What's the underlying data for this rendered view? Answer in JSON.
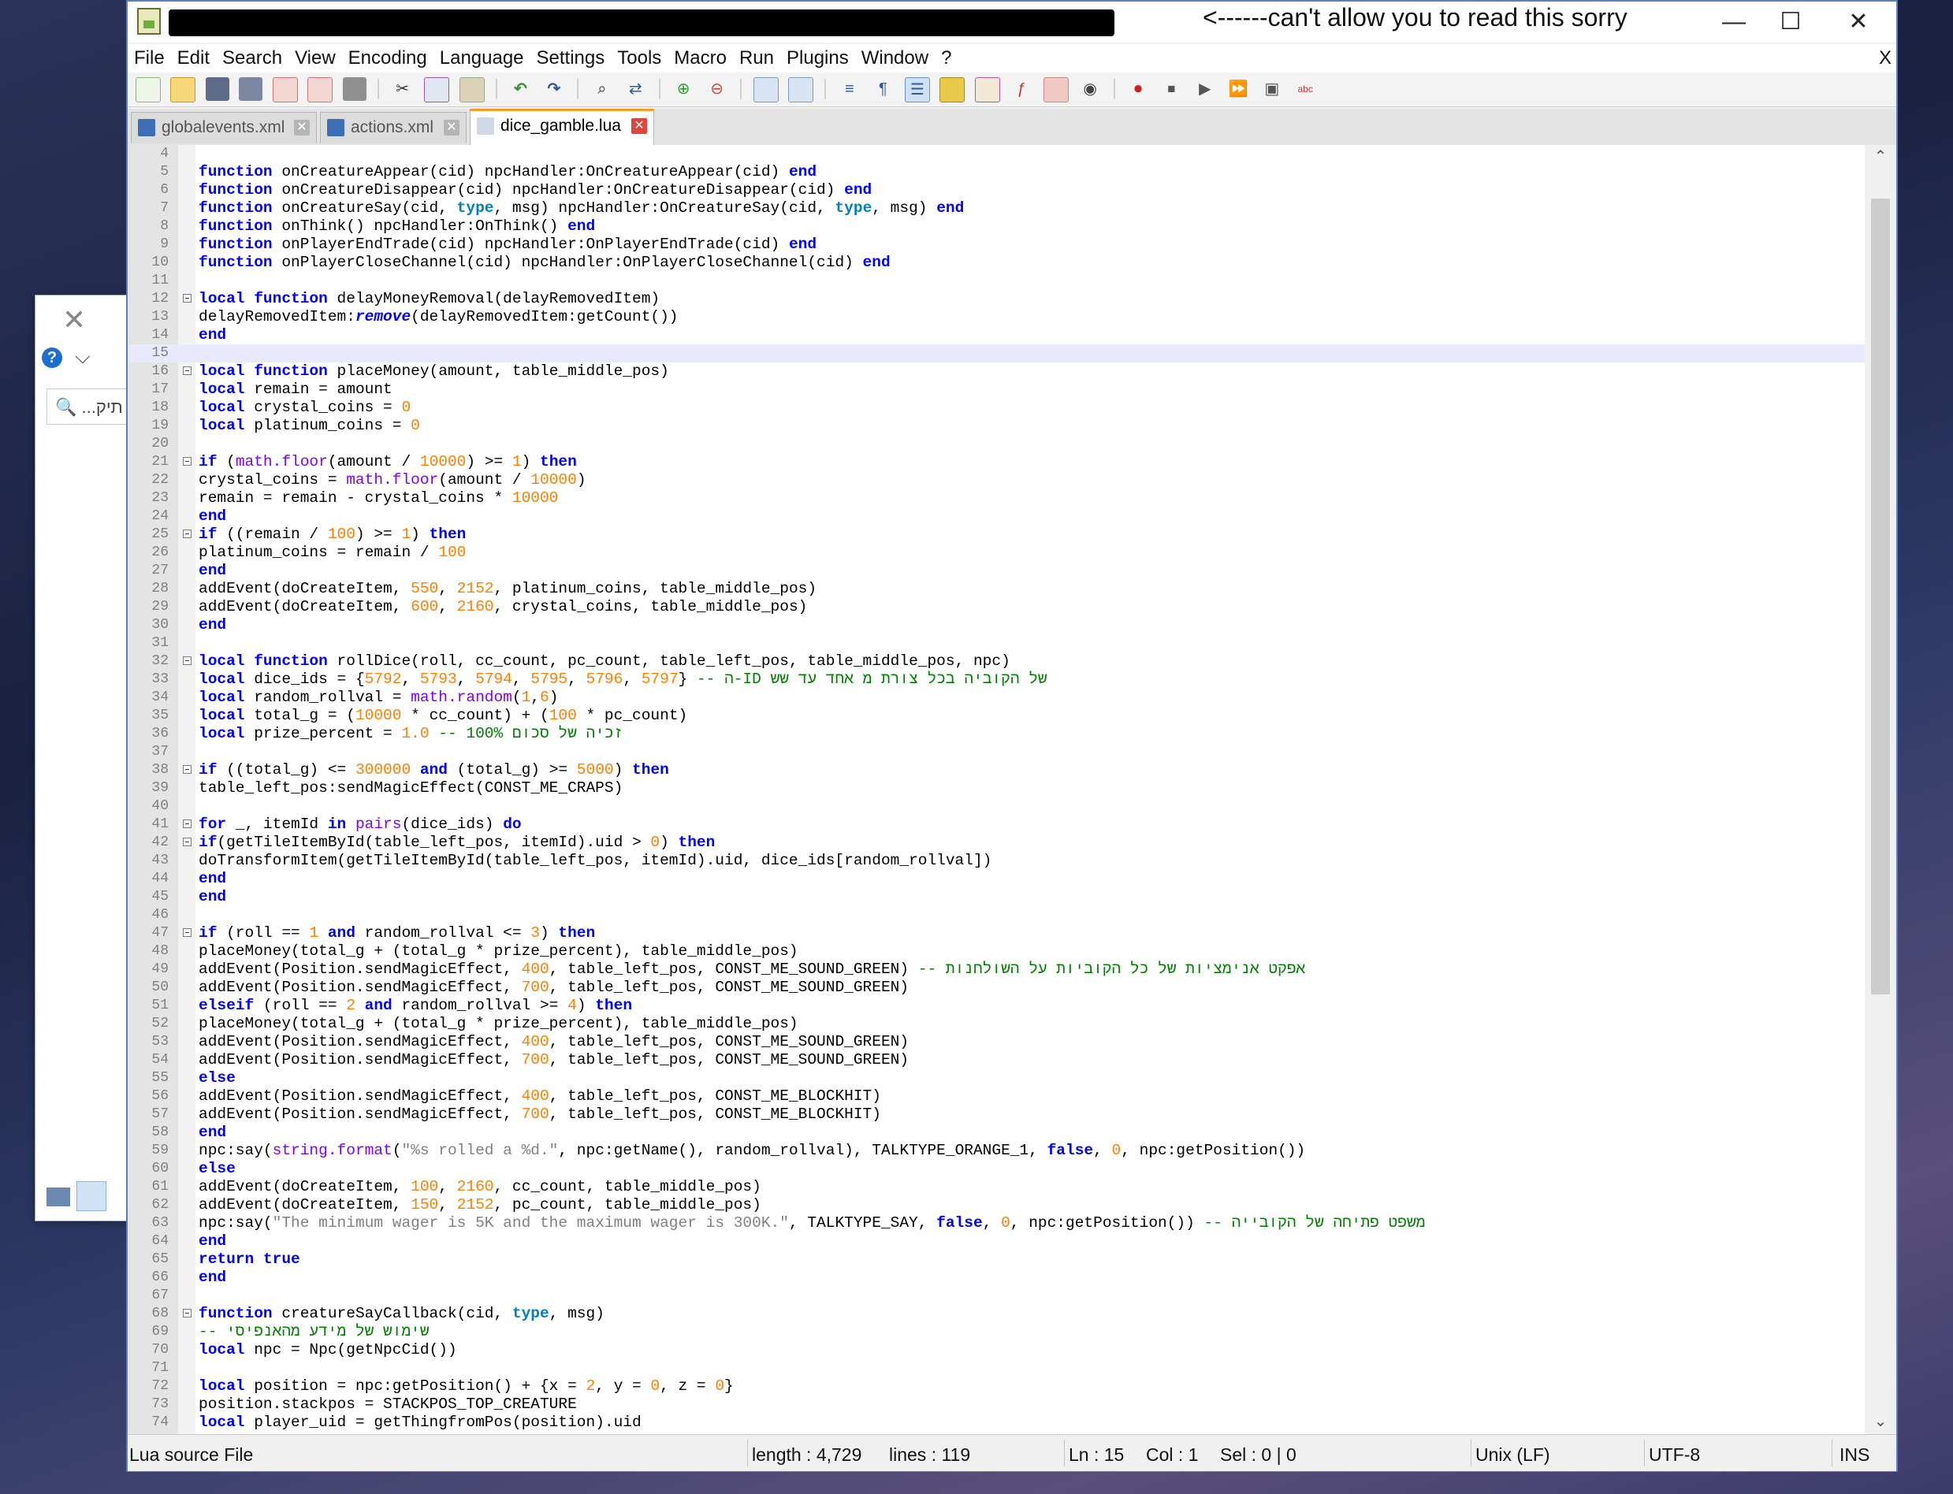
{
  "window": {
    "title_note": "<------can't allow you to read this sorry",
    "minimize": "—",
    "maximize": "☐",
    "close": "✕"
  },
  "bg_dialog": {
    "close": "✕",
    "help": "?",
    "chevron": "⌵",
    "search_text": "🔍 ...תיק"
  },
  "menu": [
    "File",
    "Edit",
    "Search",
    "View",
    "Encoding",
    "Language",
    "Settings",
    "Tools",
    "Macro",
    "Run",
    "Plugins",
    "Window",
    "?"
  ],
  "menu_close": "X",
  "tabs": [
    {
      "label": "globalevents.xml",
      "active": false
    },
    {
      "label": "actions.xml",
      "active": false
    },
    {
      "label": "dice_gamble.lua",
      "active": true
    }
  ],
  "tab_close": "✕",
  "current_line": 15,
  "code_lines": [
    {
      "n": "4",
      "h": ""
    },
    {
      "n": "5",
      "h": "<span class=\"kw\">function</span> onCreatureAppear(cid) npcHandler:OnCreatureAppear(cid) <span class=\"kw\">end</span>"
    },
    {
      "n": "6",
      "h": "<span class=\"kw\">function</span> onCreatureDisappear(cid) npcHandler:OnCreatureDisappear(cid) <span class=\"kw\">end</span>"
    },
    {
      "n": "7",
      "h": "<span class=\"kw\">function</span> onCreatureSay(cid, <span class=\"kwl\">type</span>, msg) npcHandler:OnCreatureSay(cid, <span class=\"kwl\">type</span>, msg) <span class=\"kw\">end</span>"
    },
    {
      "n": "8",
      "h": "<span class=\"kw\">function</span> onThink() npcHandler:OnThink() <span class=\"kw\">end</span>"
    },
    {
      "n": "9",
      "h": "<span class=\"kw\">function</span> onPlayerEndTrade(cid) npcHandler:OnPlayerEndTrade(cid) <span class=\"kw\">end</span>"
    },
    {
      "n": "10",
      "h": "<span class=\"kw\">function</span> onPlayerCloseChannel(cid) npcHandler:OnPlayerCloseChannel(cid) <span class=\"kw\">end</span>"
    },
    {
      "n": "11",
      "h": ""
    },
    {
      "n": "12",
      "f": 1,
      "h": "<span class=\"kw\">local</span> <span class=\"kw\">function</span> delayMoneyRemoval(delayRemovedItem)"
    },
    {
      "n": "13",
      "h": "delayRemovedItem:<span class=\"kw\"><i>remove</i></span>(delayRemovedItem:getCount())"
    },
    {
      "n": "14",
      "h": "<span class=\"kw\">end</span>"
    },
    {
      "n": "15",
      "h": ""
    },
    {
      "n": "16",
      "f": 1,
      "h": "<span class=\"kw\">local</span> <span class=\"kw\">function</span> placeMoney(amount, table_middle_pos)"
    },
    {
      "n": "17",
      "h": "<span class=\"kw\">local</span> remain = amount"
    },
    {
      "n": "18",
      "h": "<span class=\"kw\">local</span> crystal_coins = <span class=\"num\">0</span>"
    },
    {
      "n": "19",
      "h": "<span class=\"kw\">local</span> platinum_coins = <span class=\"num\">0</span>"
    },
    {
      "n": "20",
      "h": ""
    },
    {
      "n": "21",
      "f": 1,
      "h": "<span class=\"kw\">if</span> (<span class=\"lib\">math.floor</span>(amount / <span class=\"num\">10000</span>) >= <span class=\"num\">1</span>) <span class=\"kw\">then</span>"
    },
    {
      "n": "22",
      "h": "crystal_coins = <span class=\"lib\">math.floor</span>(amount / <span class=\"num\">10000</span>)"
    },
    {
      "n": "23",
      "h": "remain = remain - crystal_coins * <span class=\"num\">10000</span>"
    },
    {
      "n": "24",
      "h": "<span class=\"kw\">end</span>"
    },
    {
      "n": "25",
      "f": 1,
      "h": "<span class=\"kw\">if</span> ((remain / <span class=\"num\">100</span>) >= <span class=\"num\">1</span>) <span class=\"kw\">then</span>"
    },
    {
      "n": "26",
      "h": "platinum_coins = remain / <span class=\"num\">100</span>"
    },
    {
      "n": "27",
      "h": "<span class=\"kw\">end</span>"
    },
    {
      "n": "28",
      "h": "addEvent(doCreateItem, <span class=\"num\">550</span>, <span class=\"num\">2152</span>, platinum_coins, table_middle_pos)"
    },
    {
      "n": "29",
      "h": "addEvent(doCreateItem, <span class=\"num\">600</span>, <span class=\"num\">2160</span>, crystal_coins, table_middle_pos)"
    },
    {
      "n": "30",
      "h": "<span class=\"kw\">end</span>"
    },
    {
      "n": "31",
      "h": ""
    },
    {
      "n": "32",
      "f": 1,
      "h": "<span class=\"kw\">local</span> <span class=\"kw\">function</span> rollDice(roll, cc_count, pc_count, table_left_pos, table_middle_pos, npc)"
    },
    {
      "n": "33",
      "h": "<span class=\"kw\">local</span> dice_ids = {<span class=\"num\">5792</span>, <span class=\"num\">5793</span>, <span class=\"num\">5794</span>, <span class=\"num\">5795</span>, <span class=\"num\">5796</span>, <span class=\"num\">5797</span>} <span class=\"cmt\">-- ה-ID של הקוביה בכל צורת מ אחד עד שש</span>"
    },
    {
      "n": "34",
      "h": "<span class=\"kw\">local</span> random_rollval = <span class=\"lib\">math.random</span>(<span class=\"num\">1</span>,<span class=\"num\">6</span>)"
    },
    {
      "n": "35",
      "h": "<span class=\"kw\">local</span> total_g = (<span class=\"num\">10000</span> * cc_count) + (<span class=\"num\">100</span> * pc_count)"
    },
    {
      "n": "36",
      "h": "<span class=\"kw\">local</span> prize_percent = <span class=\"num\">1.0</span> <span class=\"cmt\">-- 100% זכיה של סכום</span>"
    },
    {
      "n": "37",
      "h": ""
    },
    {
      "n": "38",
      "f": 1,
      "h": "<span class=\"kw\">if</span> ((total_g) <= <span class=\"num\">300000</span> <span class=\"kw\">and</span> (total_g) >= <span class=\"num\">5000</span>) <span class=\"kw\">then</span>"
    },
    {
      "n": "39",
      "h": "table_left_pos:sendMagicEffect(CONST_ME_CRAPS)"
    },
    {
      "n": "40",
      "h": ""
    },
    {
      "n": "41",
      "f": 1,
      "h": "<span class=\"kw\">for</span> _, itemId <span class=\"kw\">in</span> <span class=\"lib\">pairs</span>(dice_ids) <span class=\"kw\">do</span>"
    },
    {
      "n": "42",
      "f": 1,
      "h": "<span class=\"kw\">if</span>(getTileItemById(table_left_pos, itemId).uid > <span class=\"num\">0</span>) <span class=\"kw\">then</span>"
    },
    {
      "n": "43",
      "h": "doTransformItem(getTileItemById(table_left_pos, itemId).uid, dice_ids[random_rollval])"
    },
    {
      "n": "44",
      "h": "<span class=\"kw\">end</span>"
    },
    {
      "n": "45",
      "h": "<span class=\"kw\">end</span>"
    },
    {
      "n": "46",
      "h": ""
    },
    {
      "n": "47",
      "f": 1,
      "h": "<span class=\"kw\">if</span> (roll == <span class=\"num\">1</span> <span class=\"kw\">and</span> random_rollval <= <span class=\"num\">3</span>) <span class=\"kw\">then</span>"
    },
    {
      "n": "48",
      "h": "placeMoney(total_g + (total_g * prize_percent), table_middle_pos)"
    },
    {
      "n": "49",
      "h": "addEvent(Position.sendMagicEffect, <span class=\"num\">400</span>, table_left_pos, CONST_ME_SOUND_GREEN) <span class=\"cmt\">-- אפקט אנימציות של כל הקוביות על השולחנות</span>"
    },
    {
      "n": "50",
      "h": "addEvent(Position.sendMagicEffect, <span class=\"num\">700</span>, table_left_pos, CONST_ME_SOUND_GREEN)"
    },
    {
      "n": "51",
      "h": "<span class=\"kw\">elseif</span> (roll == <span class=\"num\">2</span> <span class=\"kw\">and</span> random_rollval >= <span class=\"num\">4</span>) <span class=\"kw\">then</span>"
    },
    {
      "n": "52",
      "h": "placeMoney(total_g + (total_g * prize_percent), table_middle_pos)"
    },
    {
      "n": "53",
      "h": "addEvent(Position.sendMagicEffect, <span class=\"num\">400</span>, table_left_pos, CONST_ME_SOUND_GREEN)"
    },
    {
      "n": "54",
      "h": "addEvent(Position.sendMagicEffect, <span class=\"num\">700</span>, table_left_pos, CONST_ME_SOUND_GREEN)"
    },
    {
      "n": "55",
      "h": "<span class=\"kw\">else</span>"
    },
    {
      "n": "56",
      "h": "addEvent(Position.sendMagicEffect, <span class=\"num\">400</span>, table_left_pos, CONST_ME_BLOCKHIT)"
    },
    {
      "n": "57",
      "h": "addEvent(Position.sendMagicEffect, <span class=\"num\">700</span>, table_left_pos, CONST_ME_BLOCKHIT)"
    },
    {
      "n": "58",
      "h": "<span class=\"kw\">end</span>"
    },
    {
      "n": "59",
      "h": "npc:say(<span class=\"lib\">string.format</span>(<span class=\"str\">\"%s rolled a %d.\"</span>, npc:getName(), random_rollval), TALKTYPE_ORANGE_1, <span class=\"kw\">false</span>, <span class=\"num\">0</span>, npc:getPosition())"
    },
    {
      "n": "60",
      "h": "<span class=\"kw\">else</span>"
    },
    {
      "n": "61",
      "h": "addEvent(doCreateItem, <span class=\"num\">100</span>, <span class=\"num\">2160</span>, cc_count, table_middle_pos)"
    },
    {
      "n": "62",
      "h": "addEvent(doCreateItem, <span class=\"num\">150</span>, <span class=\"num\">2152</span>, pc_count, table_middle_pos)"
    },
    {
      "n": "63",
      "h": "npc:say(<span class=\"str\">\"The minimum wager is 5K and the maximum wager is 300K.\"</span>, TALKTYPE_SAY, <span class=\"kw\">false</span>, <span class=\"num\">0</span>, npc:getPosition()) <span class=\"cmt\">-- משפט פתיחה של הקובייה</span>"
    },
    {
      "n": "64",
      "h": "<span class=\"kw\">end</span>"
    },
    {
      "n": "65",
      "h": "<span class=\"kw\">return</span> <span class=\"kw\">true</span>"
    },
    {
      "n": "66",
      "h": "<span class=\"kw\">end</span>"
    },
    {
      "n": "67",
      "h": ""
    },
    {
      "n": "68",
      "f": 1,
      "h": "<span class=\"kw\">function</span> creatureSayCallback(cid, <span class=\"kwl\">type</span>, msg)"
    },
    {
      "n": "69",
      "h": "<span class=\"cmt\">-- שימוש של מידע מהאנפיסי</span>"
    },
    {
      "n": "70",
      "h": "<span class=\"kw\">local</span> npc = Npc(getNpcCid())"
    },
    {
      "n": "71",
      "h": ""
    },
    {
      "n": "72",
      "h": "<span class=\"kw\">local</span> position = npc:getPosition() + {x = <span class=\"num\">2</span>, y = <span class=\"num\">0</span>, z = <span class=\"num\">0</span>}"
    },
    {
      "n": "73",
      "h": "position.stackpos = STACKPOS_TOP_CREATURE"
    },
    {
      "n": "74",
      "h": "<span class=\"kw\">local</span> player_uid = getThingfromPos(position).uid"
    }
  ],
  "status": {
    "file_type": "Lua source File",
    "length": "length : 4,729",
    "lines": "lines : 119",
    "ln": "Ln : 15",
    "col": "Col : 1",
    "sel": "Sel : 0 | 0",
    "eol": "Unix (LF)",
    "encoding": "UTF-8",
    "mode": "INS"
  },
  "colors": {
    "keyword": "#0000ff",
    "number": "#ff8000",
    "library": "#8000ff",
    "string": "#808080",
    "comment": "#008000",
    "active_tab_accent": "#f39c2b"
  }
}
